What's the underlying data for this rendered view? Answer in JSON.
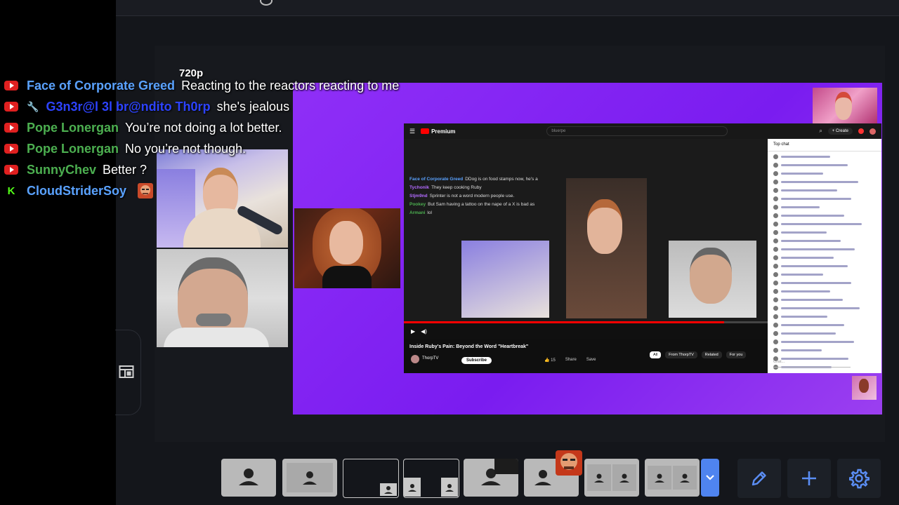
{
  "resolution_label": "720p",
  "chat": [
    {
      "platform": "youtube",
      "name": "Face of Corporate Greed",
      "name_color": "#5aa2ff",
      "message": "Reacting to the reactors reacting to me"
    },
    {
      "platform": "youtube",
      "moderator": true,
      "name": "G3n3r@l 3l br@ndito Th0rp",
      "name_color": "#2d43ff",
      "message": "she's jealous"
    },
    {
      "platform": "youtube",
      "name": "Pope Lonergan",
      "name_color": "#4caf50",
      "message": "You’re not doing a lot better."
    },
    {
      "platform": "youtube",
      "name": "Pope Lonergan",
      "name_color": "#4caf50",
      "message": "No you’re not though."
    },
    {
      "platform": "youtube",
      "name": "SunnyChev",
      "name_color": "#4caf50",
      "message": "Better ?"
    },
    {
      "platform": "kick",
      "name": "CloudStriderSoy",
      "name_color": "#5aa2ff",
      "message": ""
    }
  ],
  "browser": {
    "logo": "Premium",
    "search": "bluerpe",
    "create_label": "+ Create",
    "video_title": "Inside Ruby's Pain: Beyond the Word \"Heartbreak\"",
    "channel": "ThorpTV",
    "subscribe_label": "Subscribe",
    "like_count": "15",
    "share_label": "Share",
    "save_label": "Save",
    "filters": [
      "All",
      "From ThorpTV",
      "Related",
      "For you"
    ],
    "chat_header": "Top chat",
    "chat_input_placeholder": "Chat...",
    "mini_chat": [
      {
        "name": "Face of Corporate Greed",
        "color": "#5aa2ff",
        "message": "DDog is on food stamps now, he's a"
      },
      {
        "name": "Tychonik",
        "color": "#b36bff",
        "message": "They keep cooking Ruby"
      },
      {
        "name": "Stjm9nd",
        "color": "#b36bff",
        "message": "Sprinter is not a word modern people use."
      },
      {
        "name": "Pookey",
        "color": "#4caf50",
        "message": "But Sam having a tattoo on the nape of a X is bad as"
      },
      {
        "name": "Armani",
        "color": "#4caf50",
        "message": "lol"
      }
    ]
  },
  "toolbar": {
    "edit_icon": "pencil-icon",
    "add_icon": "plus-icon",
    "settings_icon": "gear-icon",
    "accent": "#4f84f0"
  }
}
